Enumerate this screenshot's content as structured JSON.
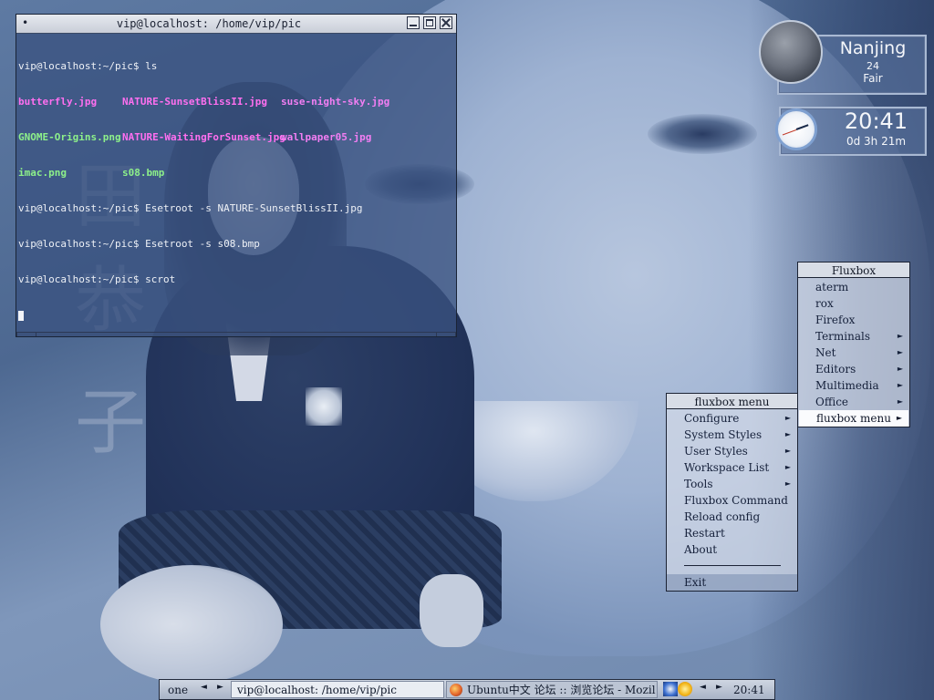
{
  "terminal": {
    "title": "vip@localhost: /home/vip/pic",
    "menu_glyph": "•",
    "lines": [
      {
        "prompt": "vip@localhost:~/pic$ ",
        "cmd": "ls"
      },
      {
        "files": [
          "butterfly.jpg",
          "NATURE-SunsetBlissII.jpg",
          "suse-night-sky.jpg"
        ]
      },
      {
        "files": [
          "GNOME-Origins.png",
          "NATURE-WaitingForSunset.jpg",
          "wallpaper05.jpg"
        ]
      },
      {
        "files": [
          "imac.png",
          "s08.bmp"
        ]
      },
      {
        "prompt": "vip@localhost:~/pic$ ",
        "cmd": "Esetroot -s NATURE-SunsetBlissII.jpg"
      },
      {
        "prompt": "vip@localhost:~/pic$ ",
        "cmd": "Esetroot -s s08.bmp"
      },
      {
        "prompt": "vip@localhost:~/pic$ ",
        "cmd": "scrot"
      }
    ]
  },
  "wallpaper": {
    "chars": [
      "田",
      "恭",
      "子"
    ]
  },
  "weather": {
    "city": "Nanjing",
    "temp": "24",
    "condition": "Fair"
  },
  "clock_widget": {
    "time": "20:41",
    "uptime": "0d 3h 21m"
  },
  "fluxbox_menu": {
    "title": "Fluxbox",
    "items": [
      {
        "label": "aterm",
        "submenu": false
      },
      {
        "label": "rox",
        "submenu": false
      },
      {
        "label": "Firefox",
        "submenu": false
      },
      {
        "label": "Terminals",
        "submenu": true
      },
      {
        "label": "Net",
        "submenu": true
      },
      {
        "label": "Editors",
        "submenu": true
      },
      {
        "label": "Multimedia",
        "submenu": true
      },
      {
        "label": "Office",
        "submenu": true
      },
      {
        "label": "fluxbox menu",
        "submenu": true,
        "active": true
      }
    ]
  },
  "fluxbox_submenu": {
    "title": "fluxbox menu",
    "items": [
      {
        "label": "Configure",
        "submenu": true
      },
      {
        "label": "System Styles",
        "submenu": true
      },
      {
        "label": "User Styles",
        "submenu": true
      },
      {
        "label": "Workspace List",
        "submenu": true
      },
      {
        "label": "Tools",
        "submenu": true
      },
      {
        "label": "Fluxbox Command",
        "submenu": false
      },
      {
        "label": "Reload config",
        "submenu": false
      },
      {
        "label": "Restart",
        "submenu": false
      },
      {
        "label": "About",
        "submenu": false
      }
    ],
    "exit_label": "Exit"
  },
  "taskbar": {
    "workspace": "one",
    "prev_glyph": "◄",
    "next_glyph": "►",
    "task_focused": "vip@localhost: /home/vip/pic",
    "task_other": "Ubuntu中文 论坛 :: 浏览论坛 - Mozil",
    "clock": "20:41"
  },
  "colors": {
    "terminal_bg": "#3a5280",
    "menu_bg": "#d2dae8",
    "menu_active": "#fafbfd",
    "file_pink": "#ff6ff0",
    "file_green": "#8df08a"
  },
  "icons": [
    "window-menu-icon",
    "minimize-icon",
    "maximize-icon",
    "close-icon",
    "moon-icon",
    "clock-icon",
    "firefox-icon",
    "network-tray-icon",
    "weather-tray-icon"
  ]
}
